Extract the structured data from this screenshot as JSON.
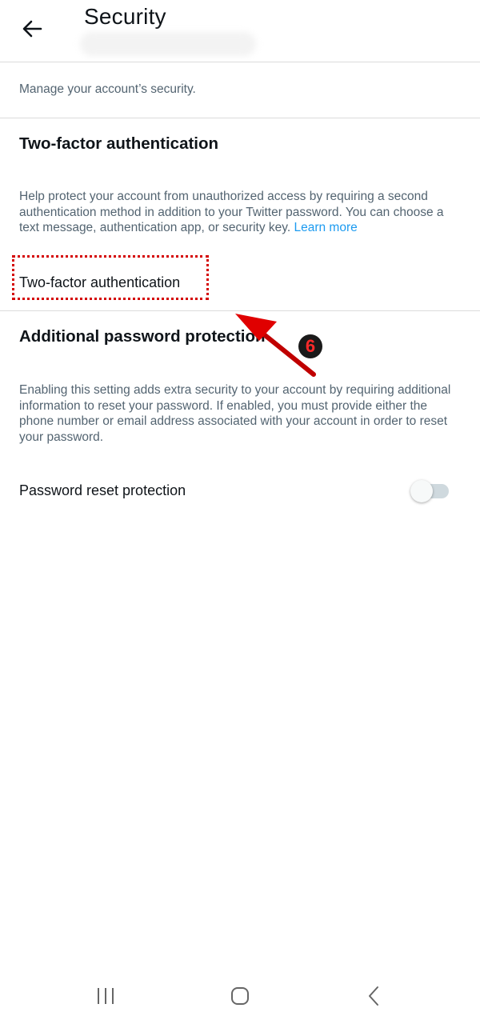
{
  "header": {
    "title": "Security",
    "back_icon": "back-arrow-icon"
  },
  "subtitle": "Manage your account’s security.",
  "two_factor": {
    "title": "Two-factor authentication",
    "description": "Help protect your account from unauthorized access by requiring a second authentication method in addition to your Twitter password. You can choose a text message, authentication app, or security key.",
    "learn_more": "Learn more",
    "row_label": "Two-factor authentication"
  },
  "password_protection": {
    "title": "Additional password protection",
    "description": "Enabling this setting adds extra security to your account by requiring additional information to reset your password. If enabled, you must provide either the phone number or email address associated with your account in order to reset your password.",
    "toggle_label": "Password reset protection",
    "toggle_on": false
  },
  "annotation": {
    "step_number": "6",
    "color": "#d40000"
  },
  "navbar": {
    "recents_icon": "recents-icon",
    "home_icon": "home-icon",
    "back_icon": "nav-back-icon"
  },
  "colors": {
    "link": "#1d9bf0",
    "text": "#0f1419",
    "secondary": "#536471"
  }
}
